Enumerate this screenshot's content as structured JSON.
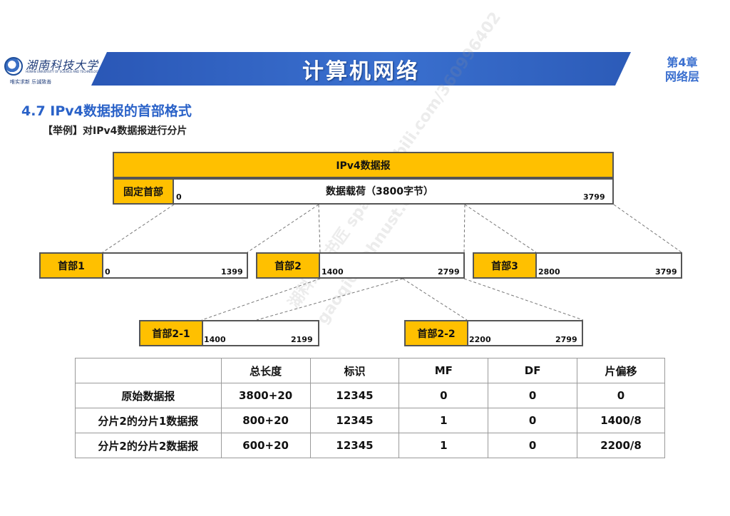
{
  "header": {
    "logo_script": "湖南科技大学",
    "logo_sub": "HUNAN UNIVERSITY OF SCIENCE AND TECHNOLOGY",
    "logo_motto": "唯实求新   乐诚致善",
    "course_title": "计算机网络",
    "chapter_line1": "第4章",
    "chapter_line2": "网络层"
  },
  "section_title": "4.7 IPv4数据报的首部格式",
  "example_text": "【举例】对IPv4数据报进行分片",
  "diagram": {
    "datagram_label": "IPv4数据报",
    "fixed_header_label": "固定首部",
    "payload_label": "数据载荷（3800字节）",
    "payload_start": "0",
    "payload_end": "3799",
    "fragments": [
      {
        "header": "首部1",
        "start": "0",
        "end": "1399"
      },
      {
        "header": "首部2",
        "start": "1400",
        "end": "2799"
      },
      {
        "header": "首部3",
        "start": "2800",
        "end": "3799"
      }
    ],
    "subfragments": [
      {
        "header": "首部2-1",
        "start": "1400",
        "end": "2199"
      },
      {
        "header": "首部2-2",
        "start": "2200",
        "end": "2799"
      }
    ]
  },
  "table": {
    "headers": [
      "",
      "总长度",
      "标识",
      "MF",
      "DF",
      "片偏移"
    ],
    "rows": [
      [
        "原始数据报",
        "3800+20",
        "12345",
        "0",
        "0",
        "0"
      ],
      [
        "分片2的分片1数据报",
        "800+20",
        "12345",
        "1",
        "0",
        "1400/8"
      ],
      [
        "分片2的分片2数据报",
        "600+20",
        "12345",
        "1",
        "0",
        "2200/8"
      ]
    ]
  },
  "watermark": {
    "line1": "湖科大教书匠 space.bilibili.com/360996402",
    "line2": "gaoqi01@hnust.edu.cn"
  },
  "colors": {
    "banner": "#3a70cf",
    "accent_gold": "#ffc000",
    "section_title": "#2a62c8"
  }
}
